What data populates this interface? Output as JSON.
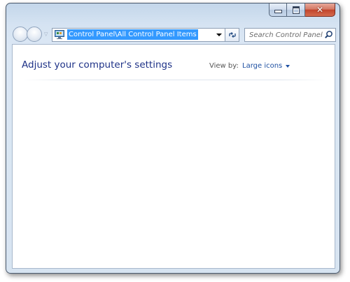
{
  "window": {
    "caption_buttons": {
      "minimize": "minimize",
      "maximize": "maximize",
      "close": "✕"
    }
  },
  "navigation": {
    "address_path": "Control Panel\\All Control Panel Items",
    "refresh_icon": "refresh-icon",
    "search": {
      "placeholder": "Search Control Panel"
    }
  },
  "content": {
    "heading": "Adjust your computer's settings",
    "view_by_label": "View by:",
    "view_by_value": "Large icons"
  },
  "colors": {
    "selection": "#3399ff",
    "heading": "#1e3287",
    "link": "#1e50a2",
    "close_button": "#c2442b"
  }
}
